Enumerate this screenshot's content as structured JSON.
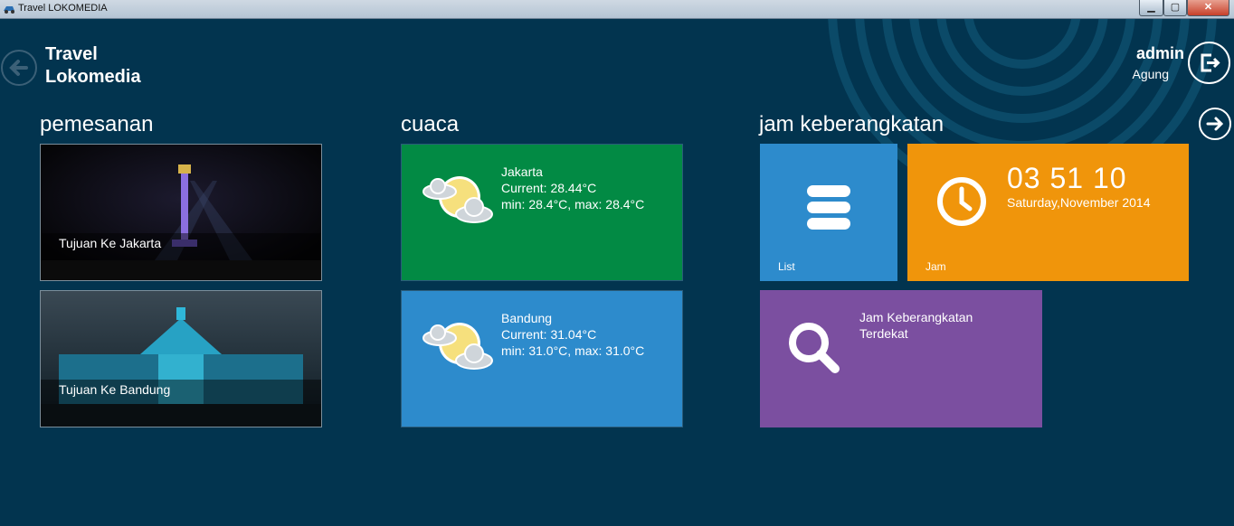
{
  "window": {
    "title": "Travel LOKOMEDIA"
  },
  "header": {
    "app_name": "Travel Lokomedia",
    "user_name": "admin",
    "user_sub": "Agung"
  },
  "sections": {
    "pemesanan": {
      "title": "pemesanan",
      "tiles": [
        {
          "label": "Tujuan Ke Jakarta"
        },
        {
          "label": "Tujuan Ke Bandung"
        }
      ]
    },
    "cuaca": {
      "title": "cuaca",
      "tiles": [
        {
          "city": "Jakarta",
          "current": "Current: 28.44°C",
          "range": "min: 28.4°C, max: 28.4°C",
          "color": "#028a44"
        },
        {
          "city": "Bandung",
          "current": "Current: 31.04°C",
          "range": "min: 31.0°C, max: 31.0°C",
          "color": "#2d8bcc"
        }
      ]
    },
    "jam": {
      "title": "jam keberangkatan",
      "list_label": "List",
      "clock_label": "Jam",
      "clock_time": "03 51 10",
      "clock_date": "Saturday,November 2014",
      "search_label": "Jam Keberangkatan Terdekat",
      "colors": {
        "list": "#2d8bcc",
        "clock": "#f0950b",
        "search": "#7b4fa0"
      }
    }
  },
  "icons": {
    "back": "arrow-left-icon",
    "logout": "logout-icon",
    "next": "arrow-right-icon",
    "weather": "partly-cloudy-icon",
    "list": "list-icon",
    "clock": "clock-icon",
    "search": "search-icon"
  }
}
